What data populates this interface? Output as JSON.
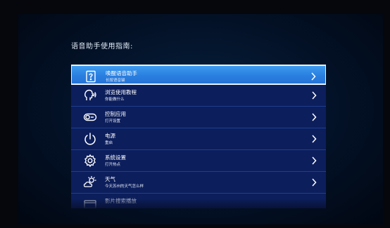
{
  "page": {
    "title": "语音助手使用指南:"
  },
  "menu": {
    "items": [
      {
        "title": "唤醒语音助手",
        "subtitle": "长按语音键",
        "icon": "book-icon"
      },
      {
        "title": "浏览使用教程",
        "subtitle": "你能做什么",
        "icon": "speaking-head-icon"
      },
      {
        "title": "控制应用",
        "subtitle": "打开设置",
        "icon": "toggle-switch-icon"
      },
      {
        "title": "电源",
        "subtitle": "重启",
        "icon": "power-icon"
      },
      {
        "title": "系统设置",
        "subtitle": "打开热点",
        "icon": "gear-icon"
      },
      {
        "title": "天气",
        "subtitle": "今天苏州的天气怎么样",
        "icon": "weather-icon"
      },
      {
        "title": "影片搜索播放",
        "subtitle": "",
        "icon": "film-icon"
      }
    ],
    "selected_index": 0
  },
  "colors": {
    "menu_bg": "#0c1e5c",
    "selected_bg": "#2f86e6",
    "divider": "#1f3f8f"
  }
}
